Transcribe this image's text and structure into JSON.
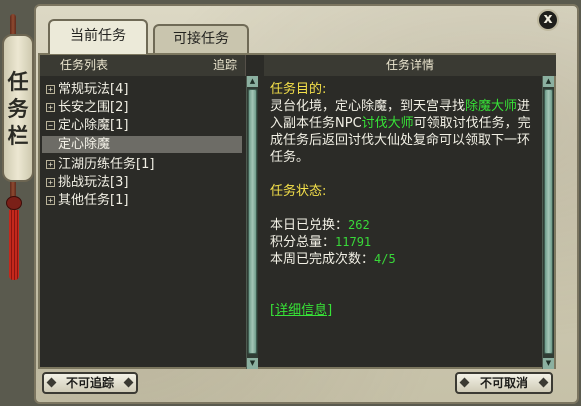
{
  "window": {
    "side_label": [
      "任",
      "务",
      "栏"
    ],
    "close_label": "x"
  },
  "tabs": [
    {
      "label": "当前任务",
      "active": true
    },
    {
      "label": "可接任务",
      "active": false
    }
  ],
  "left_panel": {
    "header_title": "任务列表",
    "header_track": "追踪",
    "items": [
      {
        "expander": "+",
        "label": "常规玩法[4]"
      },
      {
        "expander": "+",
        "label": "长安之围[2]"
      },
      {
        "expander": "−",
        "label": "定心除魔[1]"
      },
      {
        "expander": "",
        "label": "定心除魔",
        "selected": true
      },
      {
        "expander": "+",
        "label": "江湖历练任务[1]"
      },
      {
        "expander": "+",
        "label": "挑战玩法[3]"
      },
      {
        "expander": "+",
        "label": "其他任务[1]"
      }
    ]
  },
  "right_panel": {
    "header_title": "任务详情",
    "goal_label": "任务目的:",
    "goal_text_1": "灵台化境，定心除魔，到天宫寻找",
    "goal_npc": "除魔大师",
    "goal_text_2": "进入副本任务NPC",
    "goal_npc2": "讨伐大师",
    "goal_text_3": "可领取讨伐任务，完成任务后返回讨伐大仙处复命可以领取下一环任务。",
    "status_label": "任务状态:",
    "stats": [
      {
        "label": "本日已兑换：",
        "value": "262"
      },
      {
        "label": "积分总量：",
        "value": "11791"
      },
      {
        "label": "本周已完成次数：",
        "value": "4/5"
      }
    ],
    "detail_link": "[详细信息]"
  },
  "buttons": {
    "untrack": "不可追踪",
    "uncancel": "不可取消"
  }
}
